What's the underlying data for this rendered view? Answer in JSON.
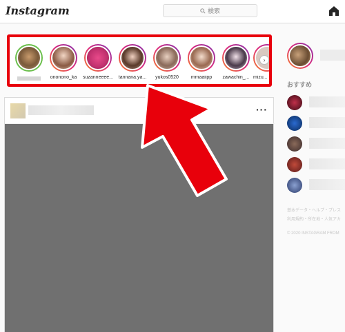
{
  "header": {
    "logo": "Instagram",
    "search_placeholder": "検索",
    "icons": {
      "search": "search-icon",
      "home": "home-icon"
    }
  },
  "stories": [
    {
      "username": "",
      "seen": true
    },
    {
      "username": "ononono_ka"
    },
    {
      "username": "suzanneeee..."
    },
    {
      "username": "tannana.ya..."
    },
    {
      "username": "yukos0520"
    },
    {
      "username": "mmaaiipp"
    },
    {
      "username": "zawachin_..."
    },
    {
      "username": "mizu..."
    }
  ],
  "stories_next_icon": "chevron-right-icon",
  "post": {
    "more_label": "···"
  },
  "sidebar": {
    "recommend_title": "おすすめ",
    "footer_line1": "基本データ・ヘルプ・プレス",
    "footer_line2": "利用規約・所在地・人気アカ",
    "copyright": "© 2020 INSTAGRAM FROM"
  },
  "colors": {
    "highlight": "#e8000b",
    "arrow": "#e8000b"
  }
}
